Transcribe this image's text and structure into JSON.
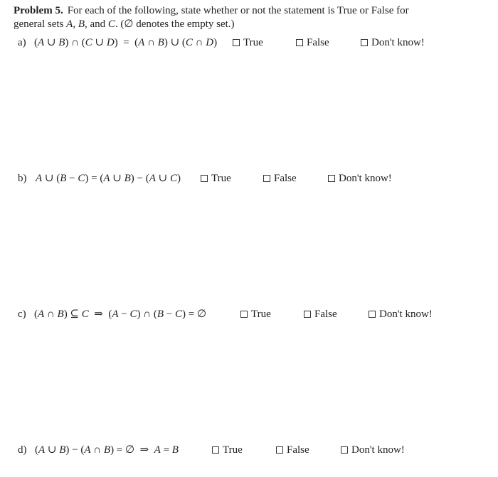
{
  "problem": {
    "title": "Problem 5.",
    "intro_line1": "For each of the following, state whether or not the statement is True or False for",
    "intro_line2_pre": "general sets ",
    "set_a": "A",
    "sep1": ", ",
    "set_b": "B",
    "sep2": ", and ",
    "set_c": "C",
    "intro_line2_post": ". (∅ denotes the empty set.)"
  },
  "options": {
    "true_label": "True",
    "false_label": "False",
    "dont_know_label": "Don't know!"
  },
  "questions": [
    {
      "label": "a)",
      "statement": "(A ∪ B) ∩ (C ∪ D)  =  (A ∩ B) ∪ (C ∩ D)",
      "true_checked": false,
      "false_checked": false,
      "dont_know_checked": false
    },
    {
      "label": "b)",
      "statement": "A ∪ (B − C) = (A ∪ B) − (A ∪ C)",
      "true_checked": false,
      "false_checked": false,
      "dont_know_checked": false
    },
    {
      "label": "c)",
      "statement": "(A ∩ B) ⊆ C  ⇒  (A − C) ∩ (B − C) = ∅",
      "true_checked": false,
      "false_checked": false,
      "dont_know_checked": false
    },
    {
      "label": "d)",
      "statement": "(A ∪ B) − (A ∩ B) = ∅  ⇒  A = B",
      "true_checked": false,
      "false_checked": false,
      "dont_know_checked": false
    }
  ]
}
